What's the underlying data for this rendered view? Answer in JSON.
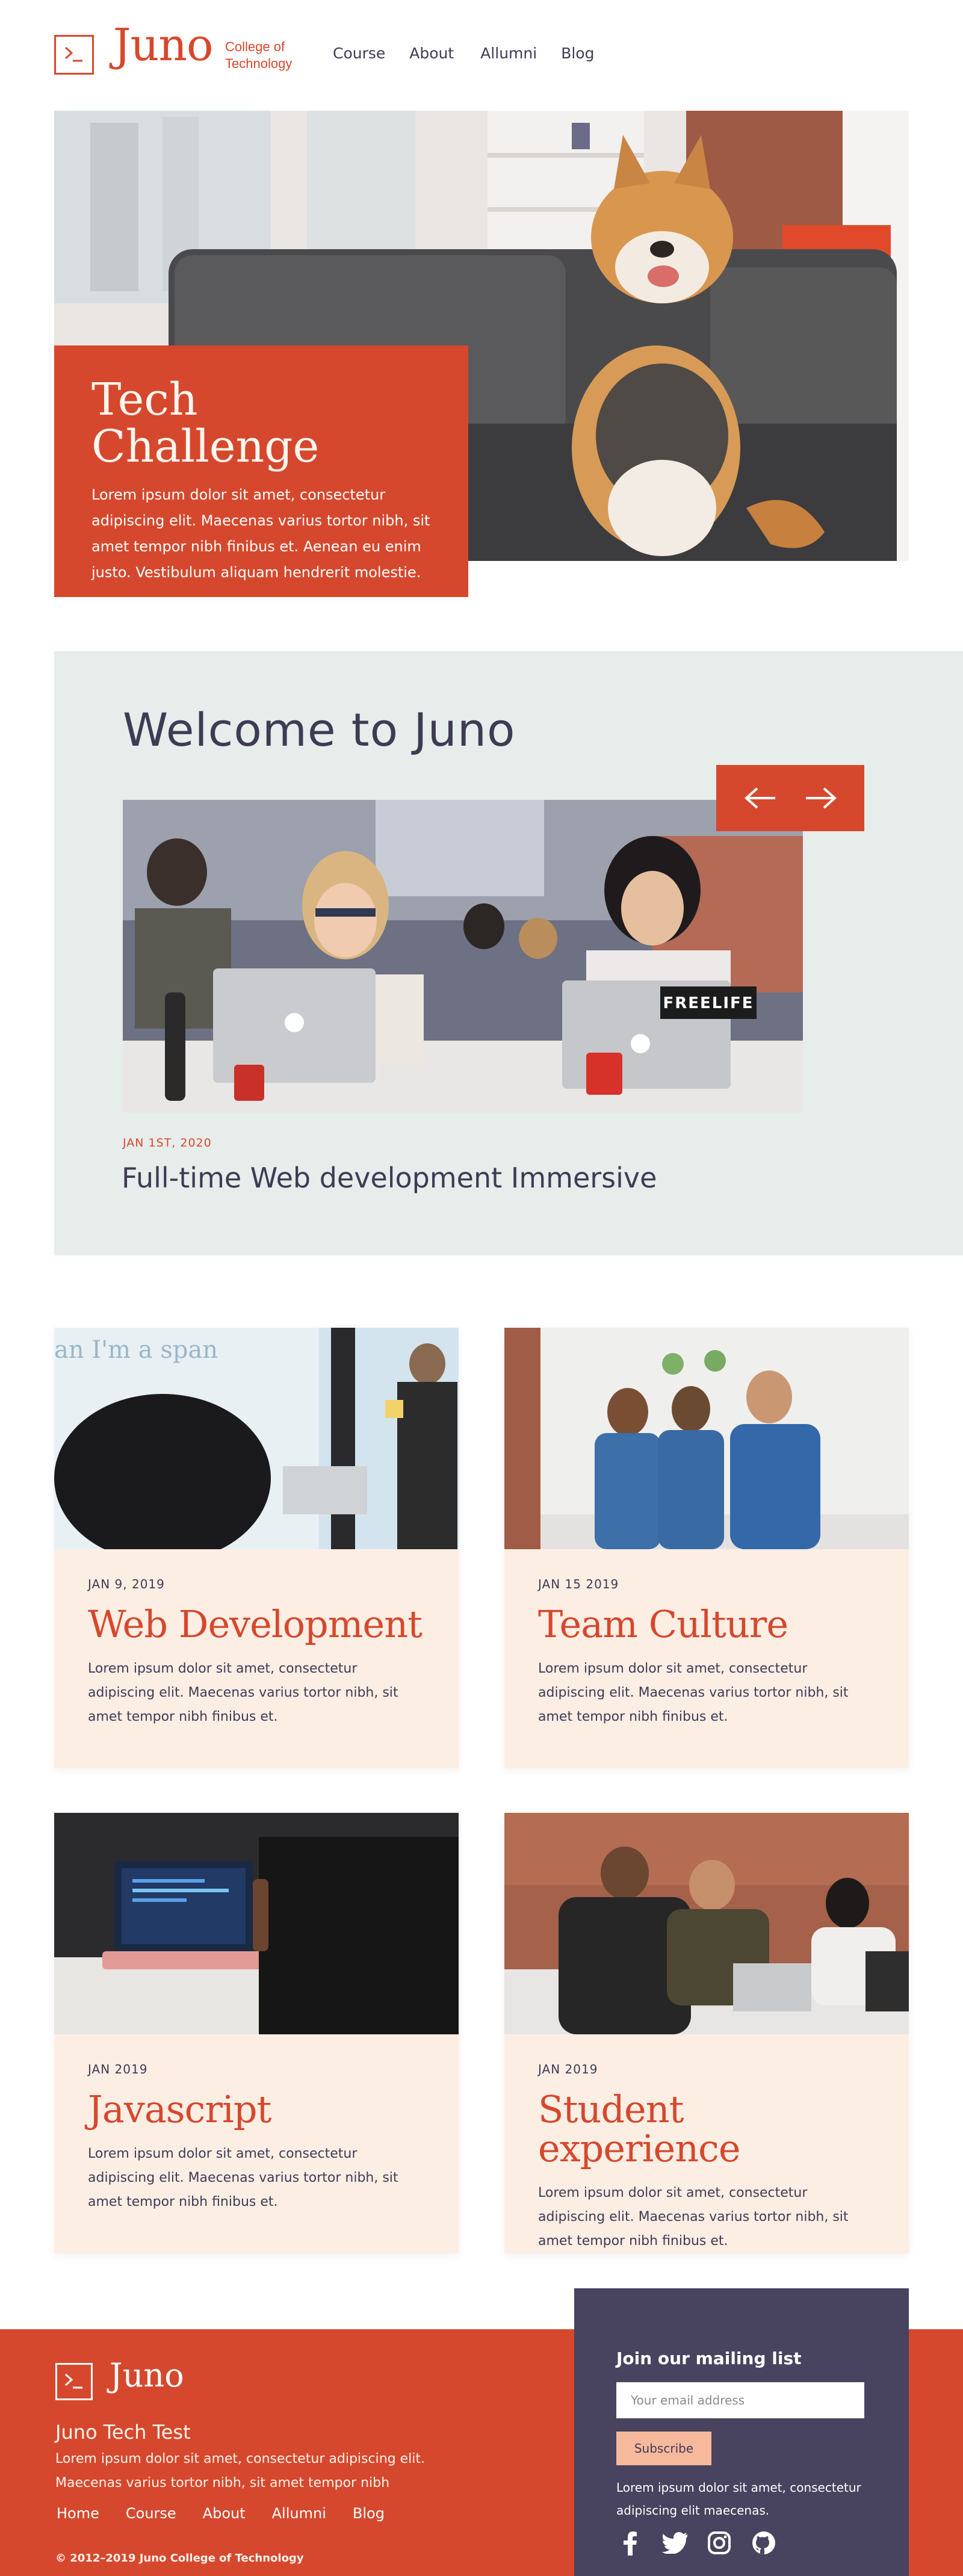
{
  "brand": {
    "name": "Juno",
    "subtitle_line1": "College of",
    "subtitle_line2": "Technology",
    "accent": "#d6482d",
    "dark": "#48435e"
  },
  "nav": {
    "items": [
      "Course",
      "About",
      "Allumni",
      "Blog"
    ]
  },
  "hero": {
    "title": "Tech Challenge",
    "text": "Lorem ipsum dolor sit amet, consectetur adipiscing elit. Maecenas varius tortor nibh, sit amet tempor nibh finibus et. Aenean eu enim justo. Vestibulum aliquam hendrerit molestie."
  },
  "welcome": {
    "title": "Welcome to Juno",
    "laptop_sticker": "FREELIFE",
    "post_date": "JAN 1ST, 2020",
    "post_title": "Full-time Web development Immersive"
  },
  "cards": [
    {
      "date": "JAN 9, 2019",
      "title": "Web Development",
      "text": "Lorem ipsum dolor sit amet, consectetur adipiscing elit. Maecenas varius tortor nibh, sit amet tempor nibh finibus et.",
      "image_text": "an I'm a span"
    },
    {
      "date": "JAN 15 2019",
      "title": "Team Culture",
      "text": "Lorem ipsum dolor sit amet, consectetur adipiscing elit. Maecenas varius tortor nibh, sit amet tempor nibh finibus et."
    },
    {
      "date": "JAN 2019",
      "title": "Javascript",
      "text": "Lorem ipsum dolor sit amet, consectetur adipiscing elit. Maecenas varius tortor nibh, sit amet tempor nibh finibus et."
    },
    {
      "date": "JAN 2019",
      "title": "Student experience",
      "text": "Lorem ipsum dolor sit amet, consectetur adipiscing elit. Maecenas varius tortor nibh, sit amet tempor nibh finibus et."
    }
  ],
  "footer": {
    "logo": "Juno",
    "title": "Juno Tech Test",
    "text": "Lorem ipsum dolor sit amet, consectetur adipiscing elit. Maecenas varius tortor nibh, sit amet tempor nibh",
    "nav": [
      "Home",
      "Course",
      "About",
      "Allumni",
      "Blog"
    ],
    "copyright": "© 2012–2019 Juno College of Technology"
  },
  "mailing": {
    "title": "Join our mailing list",
    "placeholder": "Your email address",
    "button": "Subscribe",
    "text": "Lorem ipsum dolor sit amet, consectetur adipiscing elit maecenas."
  },
  "socials": [
    "facebook-icon",
    "twitter-icon",
    "instagram-icon",
    "github-icon"
  ]
}
